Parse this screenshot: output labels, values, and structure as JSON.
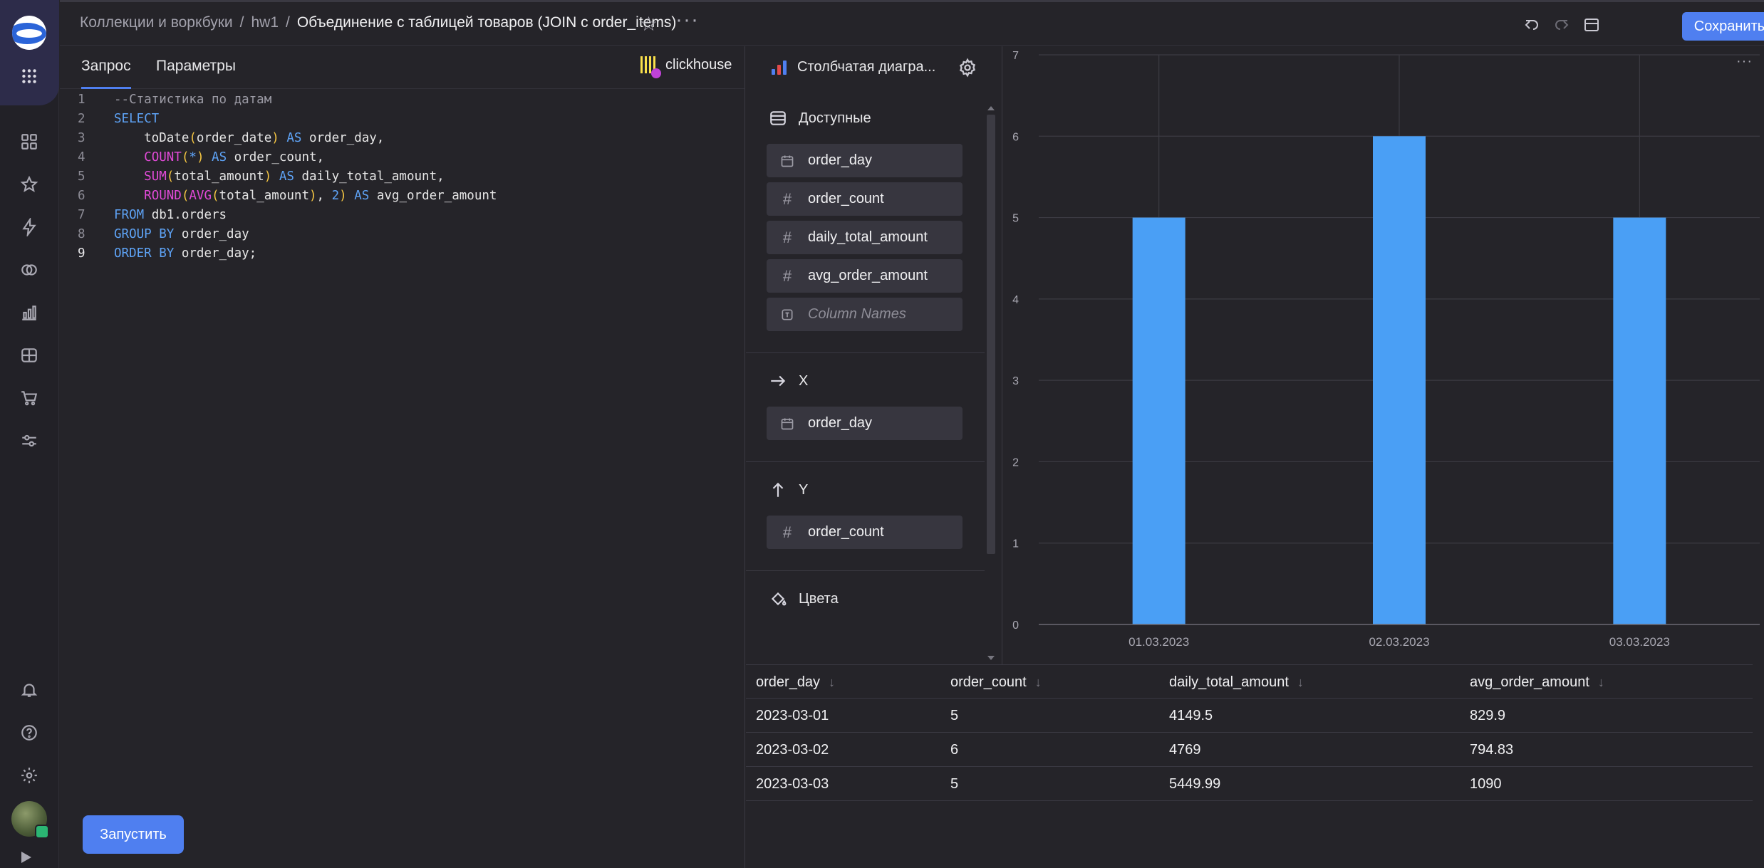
{
  "topbar": {
    "breadcrumb_collections": "Коллекции и воркбуки",
    "breadcrumb_workbook": "hw1",
    "breadcrumb_sep": "/",
    "title": "Объединение с таблицей товаров (JOIN с order_items)",
    "save_label": "Сохранить"
  },
  "editor": {
    "tab_query": "Запрос",
    "tab_params": "Параметры",
    "connection": "clickhouse",
    "run_label": "Запустить",
    "lines": [
      "1",
      "2",
      "3",
      "4",
      "5",
      "6",
      "7",
      "8",
      "9"
    ]
  },
  "wizard": {
    "chart_type_label": "Столбчатая диагра...",
    "available_title": "Доступные",
    "available_fields": [
      "order_day",
      "order_count",
      "daily_total_amount",
      "avg_order_amount",
      "Column Names"
    ],
    "x_title": "X",
    "x_field": "order_day",
    "y_title": "Y",
    "y_field": "order_count",
    "colors_title": "Цвета"
  },
  "chart_data": {
    "type": "bar",
    "categories": [
      "01.03.2023",
      "02.03.2023",
      "03.03.2023"
    ],
    "values": [
      5,
      6,
      5
    ],
    "ylim": [
      0,
      7
    ],
    "yticks": [
      "0",
      "1",
      "2",
      "3",
      "4",
      "5",
      "6",
      "7"
    ],
    "bar_color": "#4a9ff5",
    "grid": true,
    "title": "",
    "xlabel": "",
    "ylabel": ""
  },
  "table": {
    "headers": [
      "order_day",
      "order_count",
      "daily_total_amount",
      "avg_order_amount"
    ],
    "rows": [
      [
        "2023-03-01",
        "5",
        "4149.5",
        "829.9"
      ],
      [
        "2023-03-02",
        "6",
        "4769",
        "794.83"
      ],
      [
        "2023-03-03",
        "5",
        "5449.99",
        "1090"
      ]
    ]
  },
  "colors": {
    "accent": "#4f7ff0",
    "background": "#252429"
  }
}
